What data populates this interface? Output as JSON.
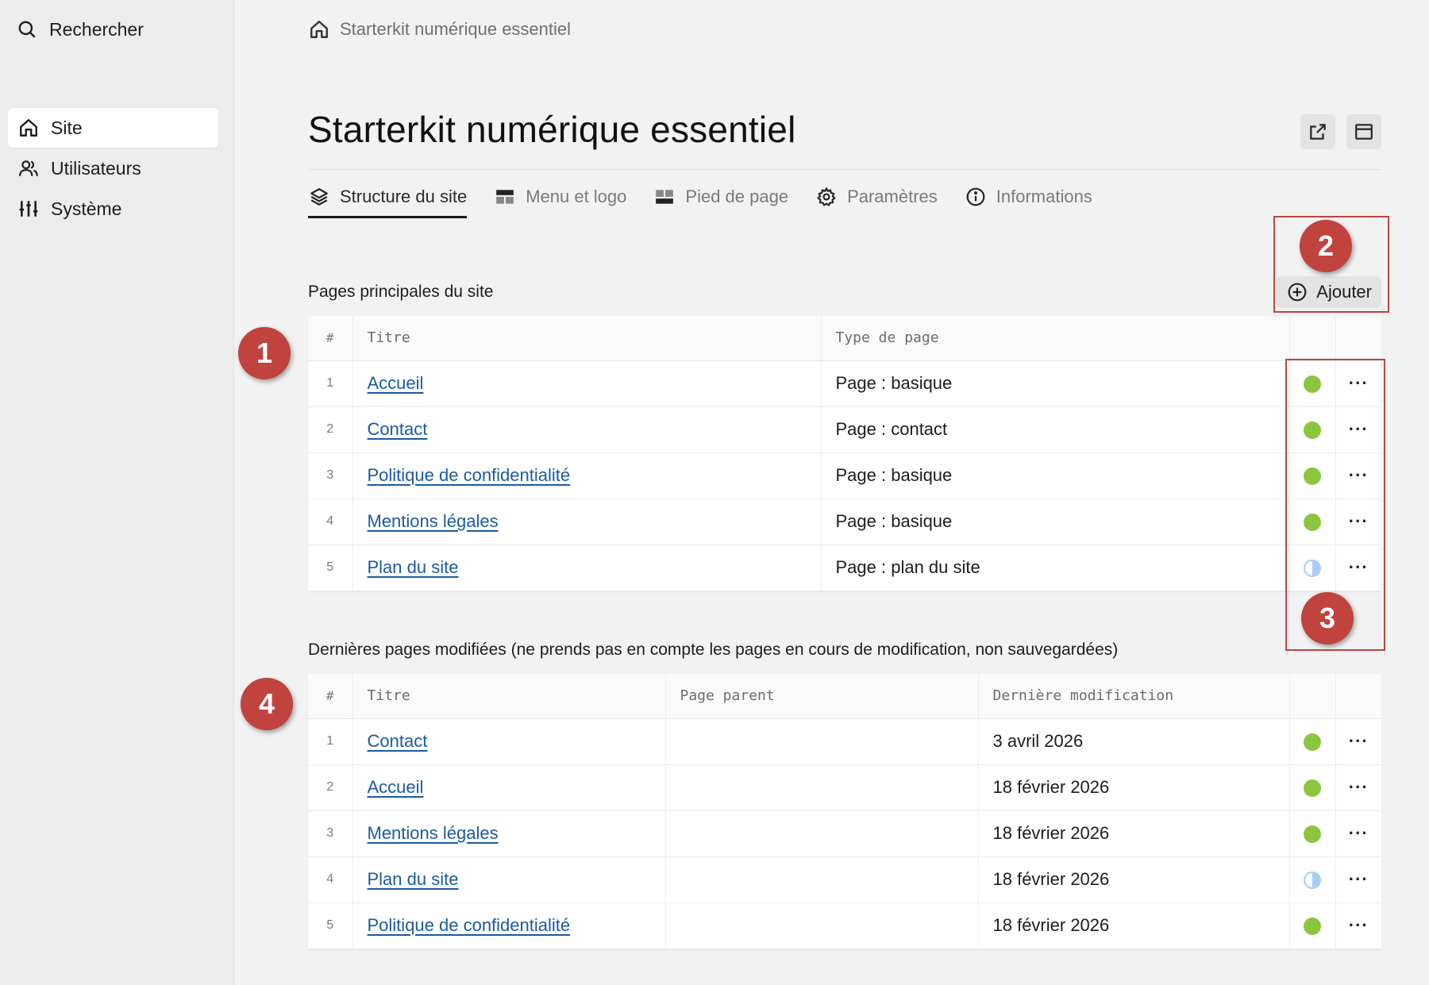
{
  "sidebar": {
    "search_label": "Rechercher",
    "items": [
      {
        "label": "Site",
        "icon": "home-icon",
        "active": true
      },
      {
        "label": "Utilisateurs",
        "icon": "users-icon",
        "active": false
      },
      {
        "label": "Système",
        "icon": "sliders-icon",
        "active": false
      }
    ]
  },
  "breadcrumb": {
    "label": "Starterkit numérique essentiel"
  },
  "page": {
    "title": "Starterkit numérique essentiel"
  },
  "tabs": [
    {
      "label": "Structure du site",
      "icon": "layers-icon",
      "active": true
    },
    {
      "label": "Menu et logo",
      "icon": "header-layout-icon",
      "active": false
    },
    {
      "label": "Pied de page",
      "icon": "footer-layout-icon",
      "active": false
    },
    {
      "label": "Paramètres",
      "icon": "gear-icon",
      "active": false
    },
    {
      "label": "Informations",
      "icon": "info-icon",
      "active": false
    }
  ],
  "main_pages": {
    "label": "Pages principales du site",
    "add_label": "Ajouter",
    "columns": {
      "num": "#",
      "title": "Titre",
      "type": "Type de page"
    },
    "rows": [
      {
        "num": "1",
        "title": "Accueil",
        "type": "Page : basique",
        "status": "published"
      },
      {
        "num": "2",
        "title": "Contact",
        "type": "Page : contact",
        "status": "published"
      },
      {
        "num": "3",
        "title": "Politique de confidentialité",
        "type": "Page : basique",
        "status": "published"
      },
      {
        "num": "4",
        "title": "Mentions légales",
        "type": "Page : basique",
        "status": "published"
      },
      {
        "num": "5",
        "title": "Plan du site",
        "type": "Page : plan du site",
        "status": "draft"
      }
    ]
  },
  "recent_pages": {
    "label": "Dernières pages modifiées (ne prends pas en compte les pages en cours de modification, non sauvegardées)",
    "columns": {
      "num": "#",
      "title": "Titre",
      "parent": "Page parent",
      "modified": "Dernière modification"
    },
    "rows": [
      {
        "num": "1",
        "title": "Contact",
        "parent": "",
        "modified": "3 avril 2026",
        "status": "published"
      },
      {
        "num": "2",
        "title": "Accueil",
        "parent": "",
        "modified": "18 février 2026",
        "status": "published"
      },
      {
        "num": "3",
        "title": "Mentions légales",
        "parent": "",
        "modified": "18 février 2026",
        "status": "published"
      },
      {
        "num": "4",
        "title": "Plan du site",
        "parent": "",
        "modified": "18 février 2026",
        "status": "draft"
      },
      {
        "num": "5",
        "title": "Politique de confidentialité",
        "parent": "",
        "modified": "18 février 2026",
        "status": "published"
      }
    ]
  },
  "more_label": "···",
  "markers": [
    "1",
    "2",
    "3",
    "4"
  ],
  "colors": {
    "accent_marker": "#c0433d",
    "published": "#8cc63f",
    "draft": "#a9cfee",
    "link": "#1b5aa3"
  }
}
